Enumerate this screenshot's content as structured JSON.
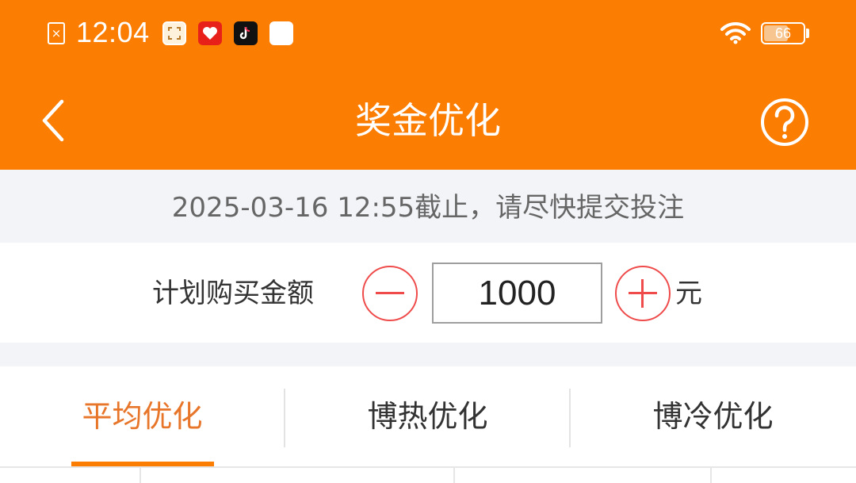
{
  "status_bar": {
    "time": "12:04",
    "battery": "66",
    "battery_level": 0.66,
    "icons": [
      "sim-card-icon",
      "scan-app-icon",
      "heart-app-icon",
      "tiktok-app-icon",
      "white-app-icon",
      "wifi-icon",
      "battery-icon"
    ]
  },
  "header": {
    "title": "奖金优化",
    "back_icon": "chevron-left-icon",
    "help_icon": "question-circle-icon",
    "background": "#fb7d02"
  },
  "notice": {
    "text": "2025-03-16 12:55截止，请尽快提交投注"
  },
  "amount": {
    "label": "计划购买金额",
    "value": "1000",
    "unit": "元",
    "accent": "#ef4b4b"
  },
  "tabs": [
    {
      "label": "平均优化",
      "active": true
    },
    {
      "label": "博热优化",
      "active": false
    },
    {
      "label": "博冷优化",
      "active": false
    }
  ],
  "colors": {
    "brand": "#fb7d02",
    "active_tab": "#e8762a",
    "notice_bg": "#f2f4f7"
  }
}
